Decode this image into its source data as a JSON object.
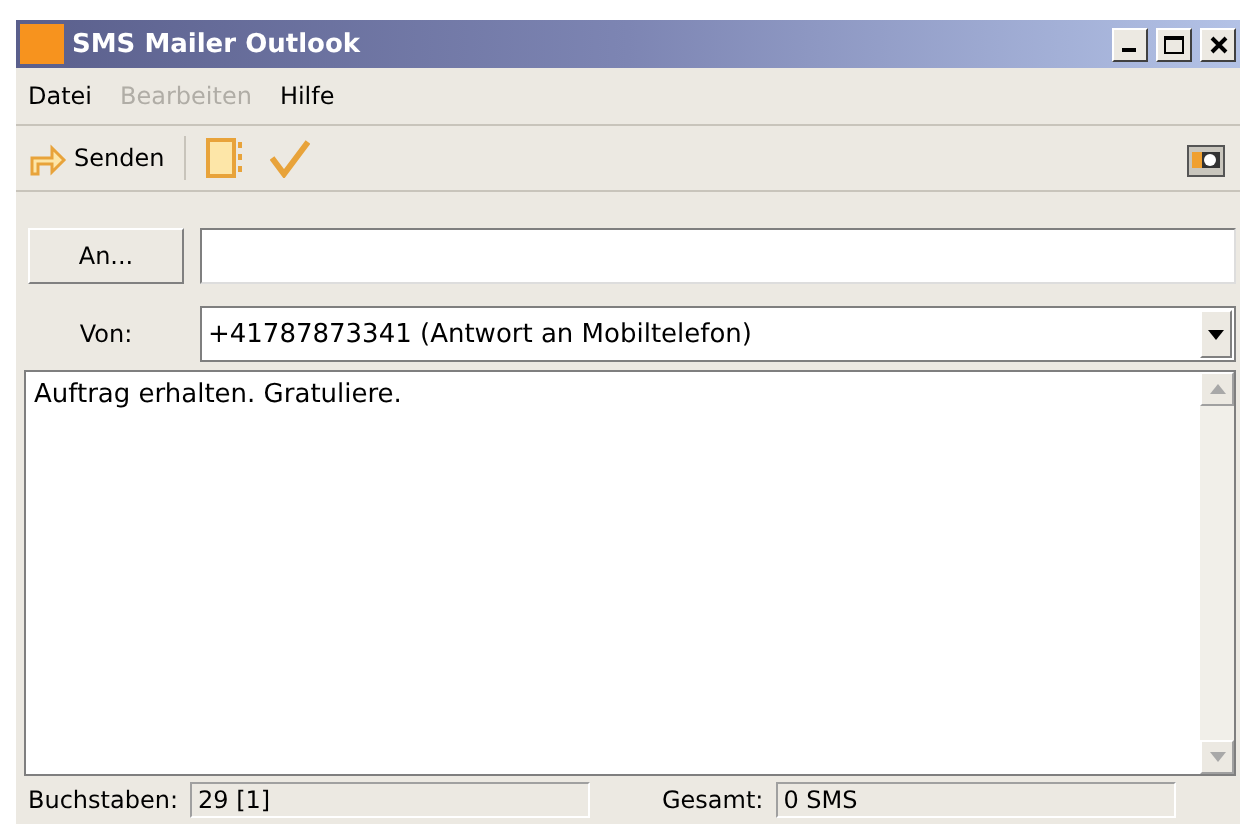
{
  "window": {
    "title": "SMS Mailer Outlook"
  },
  "menu": [
    {
      "label": "Datei",
      "disabled": false
    },
    {
      "label": "Bearbeiten",
      "disabled": true
    },
    {
      "label": "Hilfe",
      "disabled": false
    }
  ],
  "toolbar": {
    "send": "Senden"
  },
  "to": {
    "button": "An..."
  },
  "from": {
    "label": "Von:",
    "value": "+41787873341 (Antwort an Mobiltelefon)"
  },
  "message": {
    "value": "Auftrag erhalten. Gratuliere."
  },
  "status_bar": [
    {
      "label": "Buchstaben:",
      "value": "29 [1]"
    },
    {
      "label": "Gesamt:",
      "value": "0 SMS"
    }
  ]
}
